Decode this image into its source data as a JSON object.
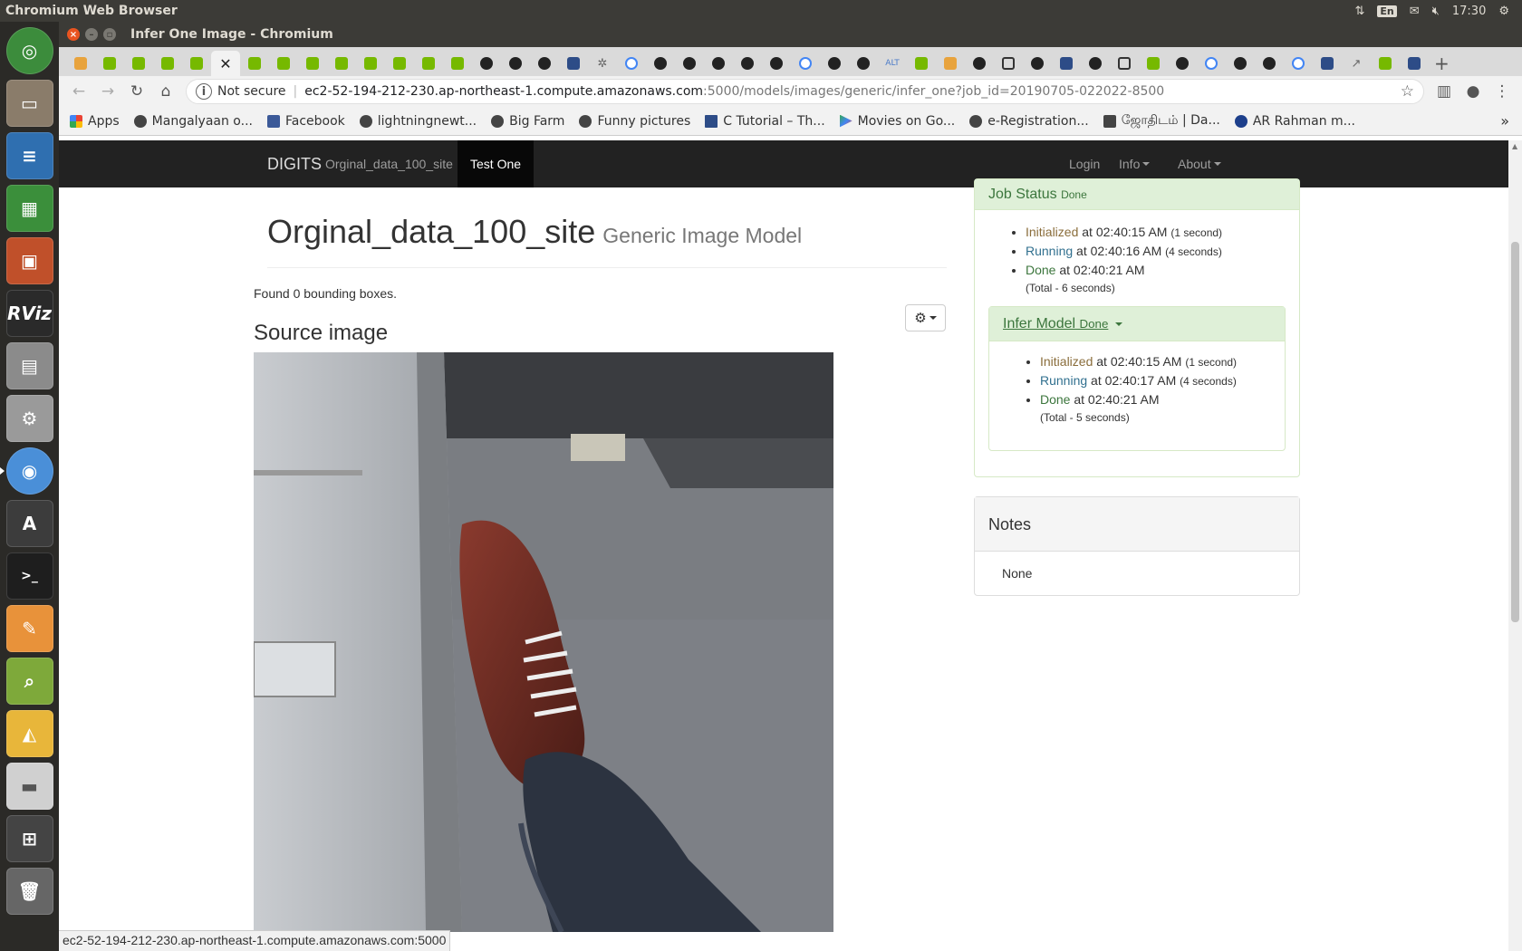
{
  "os": {
    "app_title": "Chromium Web Browser",
    "keyboard_layout": "En",
    "clock": "17:30"
  },
  "launcher": {
    "items": [
      "ubuntu-dash-icon",
      "files-icon",
      "writer-icon",
      "calc-icon",
      "impress-icon",
      "rviz-icon",
      "store-icon",
      "settings-icon",
      "chromium-icon",
      "software-updater-icon",
      "terminal-icon",
      "text-editor-icon",
      "image-viewer-icon",
      "draw-icon",
      "drive-icon",
      "workspace-switcher-icon",
      "trash-icon"
    ],
    "rviz_label": "RViz"
  },
  "window": {
    "title": "Infer One Image - Chromium"
  },
  "tabs": {
    "favicons": [
      "or",
      "nv",
      "nv",
      "nv",
      "nv",
      "active",
      "nv",
      "nv",
      "nv",
      "nv",
      "nv",
      "nv",
      "nv",
      "nv",
      "gh",
      "gh",
      "gh",
      "bl",
      "x",
      "g",
      "gh",
      "gh",
      "gh",
      "gh",
      "gh",
      "g",
      "gh",
      "gh",
      "alt",
      "nv",
      "or",
      "gh",
      "box",
      "gh",
      "bl",
      "gh",
      "box",
      "nv",
      "gh",
      "g",
      "gh",
      "gh",
      "g",
      "bl",
      "chart",
      "nv",
      "bl"
    ],
    "close_glyph": "✕",
    "new_tab_glyph": "+",
    "alt_text": "ALT"
  },
  "omnibox": {
    "security_label": "Not secure",
    "host": "ec2-52-194-212-230.ap-northeast-1.compute.amazonaws.com",
    "path": ":5000/models/images/generic/infer_one?job_id=20190705-022022-8500"
  },
  "bookmarks": [
    {
      "label": "Apps",
      "icon": "apps"
    },
    {
      "label": "Mangalyaan o...",
      "icon": "globe"
    },
    {
      "label": "Facebook",
      "icon": "fb"
    },
    {
      "label": "lightningnewt...",
      "icon": "globe"
    },
    {
      "label": "Big Farm",
      "icon": "globe"
    },
    {
      "label": "Funny pictures",
      "icon": "globe"
    },
    {
      "label": "C Tutorial – Th...",
      "icon": "ct"
    },
    {
      "label": "Movies on Go...",
      "icon": "play"
    },
    {
      "label": "e-Registration...",
      "icon": "globe"
    },
    {
      "label": "ஜோதிடம் | Da...",
      "icon": "j"
    },
    {
      "label": "AR Rahman m...",
      "icon": "r"
    }
  ],
  "navbar": {
    "brand": "DIGITS",
    "links": {
      "dataset": "Orginal_data_100_site",
      "active": "Test One",
      "login": "Login",
      "info": "Info",
      "about": "About"
    }
  },
  "page": {
    "title": "Orginal_data_100_site",
    "subtitle": "Generic Image Model",
    "found": "Found 0 bounding boxes.",
    "source_heading": "Source image"
  },
  "job_status": {
    "title": "Job Status",
    "state": "Done",
    "steps": [
      {
        "name": "Initialized",
        "time": "at 02:40:15 AM",
        "duration": "(1 second)"
      },
      {
        "name": "Running",
        "time": "at 02:40:16 AM",
        "duration": "(4 seconds)"
      },
      {
        "name": "Done",
        "time": "at 02:40:21 AM",
        "duration": ""
      }
    ],
    "total": "(Total - 6 seconds)"
  },
  "infer_model": {
    "title": "Infer Model",
    "state": "Done",
    "steps": [
      {
        "name": "Initialized",
        "time": "at 02:40:15 AM",
        "duration": "(1 second)"
      },
      {
        "name": "Running",
        "time": "at 02:40:17 AM",
        "duration": "(4 seconds)"
      },
      {
        "name": "Done",
        "time": "at 02:40:21 AM",
        "duration": ""
      }
    ],
    "total": "(Total - 5 seconds)"
  },
  "notes": {
    "title": "Notes",
    "body": "None"
  },
  "status_bar": {
    "url": "ec2-52-194-212-230.ap-northeast-1.compute.amazonaws.com:5000"
  },
  "colors": {
    "ubuntu_orange": "#e95420",
    "navbar_bg": "#222222",
    "success_bg": "#dff0d8",
    "success_text": "#3c763d"
  }
}
